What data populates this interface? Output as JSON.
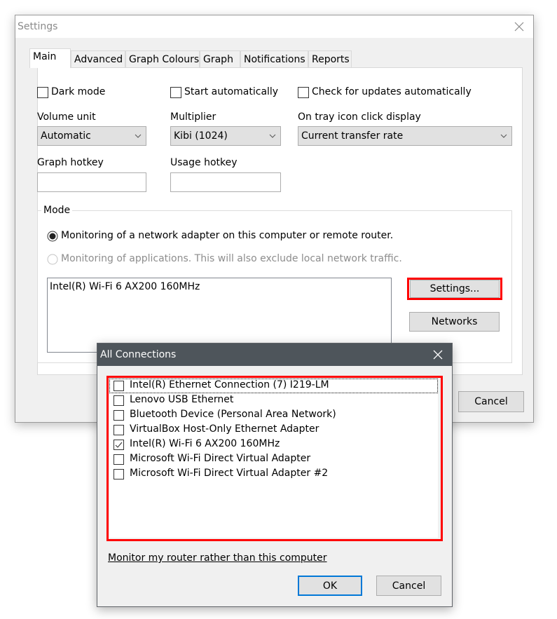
{
  "settings_window": {
    "title": "Settings",
    "close_icon": "close-icon",
    "tabs": [
      {
        "label": "Main",
        "active": true
      },
      {
        "label": "Advanced",
        "active": false
      },
      {
        "label": "Graph Colours",
        "active": false
      },
      {
        "label": "Graph",
        "active": false
      },
      {
        "label": "Notifications",
        "active": false
      },
      {
        "label": "Reports",
        "active": false
      }
    ],
    "main": {
      "dark_mode": {
        "label": "Dark mode",
        "checked": false
      },
      "start_automatically": {
        "label": "Start automatically",
        "checked": false
      },
      "check_updates": {
        "label": "Check for updates automatically",
        "checked": false
      },
      "volume_unit": {
        "label": "Volume unit",
        "value": "Automatic"
      },
      "multiplier": {
        "label": "Multiplier",
        "value": "Kibi (1024)"
      },
      "tray_click": {
        "label": "On tray icon click display",
        "value": "Current transfer rate"
      },
      "graph_hotkey": {
        "label": "Graph hotkey",
        "value": ""
      },
      "usage_hotkey": {
        "label": "Usage hotkey",
        "value": ""
      },
      "mode": {
        "label": "Mode",
        "option_adapter": {
          "label": "Monitoring of a network adapter on this computer or remote router.",
          "selected": true
        },
        "option_apps": {
          "label": "Monitoring of applications. This will also exclude local network traffic.",
          "selected": false,
          "disabled": true
        },
        "adapters": [
          "Intel(R) Wi-Fi 6 AX200 160MHz"
        ],
        "settings_button": "Settings...",
        "networks_button": "Networks"
      }
    },
    "cancel_button": "Cancel"
  },
  "connections_dialog": {
    "title": "All Connections",
    "close_icon": "close-icon",
    "items": [
      {
        "label": "Intel(R) Ethernet Connection (7) I219-LM",
        "checked": false
      },
      {
        "label": "Lenovo USB Ethernet",
        "checked": false
      },
      {
        "label": "Bluetooth Device (Personal Area Network)",
        "checked": false
      },
      {
        "label": "VirtualBox Host-Only Ethernet Adapter",
        "checked": false
      },
      {
        "label": "Intel(R) Wi-Fi 6 AX200 160MHz",
        "checked": true
      },
      {
        "label": "Microsoft Wi-Fi Direct Virtual Adapter",
        "checked": false
      },
      {
        "label": "Microsoft Wi-Fi Direct Virtual Adapter #2",
        "checked": false
      }
    ],
    "router_link": "Monitor my router rather than this computer",
    "ok_button": "OK",
    "cancel_button": "Cancel"
  },
  "colors": {
    "highlight": "#ff0000",
    "default_button_border": "#0078d7",
    "dialog_titlebar": "#4e555b"
  }
}
